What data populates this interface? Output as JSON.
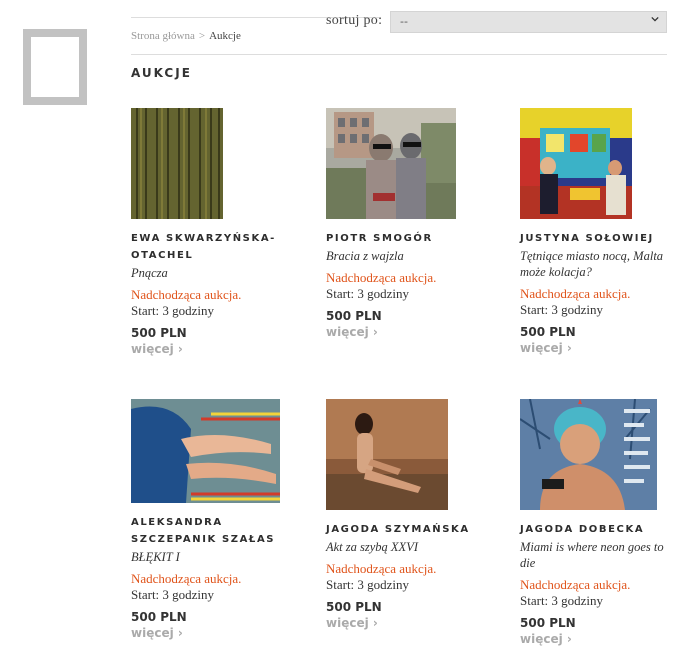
{
  "sort": {
    "label": "sortuj po:",
    "value": "--"
  },
  "breadcrumb": {
    "home": "Strona główna",
    "separator": ">",
    "current": "Aukcje"
  },
  "page_title": "AUKCJE",
  "auctions": [
    {
      "artist": "EWA SKWARZYŃSKA-OTACHEL",
      "title": "Pnącza",
      "status": "Nadchodząca aukcja.",
      "start": "Start: 3 godziny",
      "price": "500 PLN",
      "more": "więcej ›"
    },
    {
      "artist": "PIOTR SMOGÓR",
      "title": "Bracia z wajzla",
      "status": "Nadchodząca aukcja.",
      "start": "Start: 3 godziny",
      "price": "500 PLN",
      "more": "więcej ›"
    },
    {
      "artist": "JUSTYNA SOŁOWIEJ",
      "title": "Tętniące miasto nocą, Malta może kolacja?",
      "status": "Nadchodząca aukcja.",
      "start": "Start: 3 godziny",
      "price": "500 PLN",
      "more": "więcej ›"
    },
    {
      "artist": "ALEKSANDRA SZCZEPANIK SZAŁAS",
      "title": "BŁĘKIT I",
      "status": "Nadchodząca aukcja.",
      "start": "Start: 3 godziny",
      "price": "500 PLN",
      "more": "więcej ›"
    },
    {
      "artist": "JAGODA SZYMAŃSKA",
      "title": "Akt za szybą XXVI",
      "status": "Nadchodząca aukcja.",
      "start": "Start: 3 godziny",
      "price": "500 PLN",
      "more": "więcej ›"
    },
    {
      "artist": "JAGODA DOBECKA",
      "title": "Miami is where neon goes to die",
      "status": "Nadchodząca aukcja.",
      "start": "Start: 3 godziny",
      "price": "500 PLN",
      "more": "więcej ›"
    }
  ],
  "colors": {
    "status": "#e0541b",
    "more": "#aaaaaa",
    "logo": "#c2c2c2"
  }
}
